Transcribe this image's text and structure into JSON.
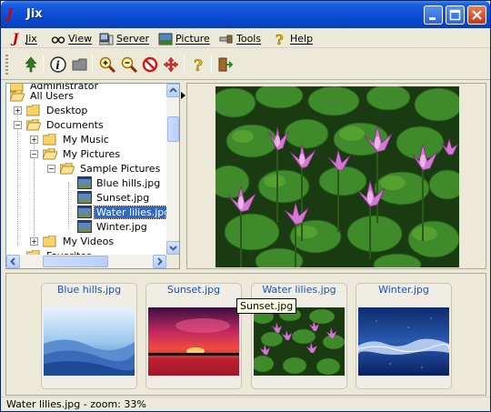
{
  "window": {
    "title": "Jix"
  },
  "menu": {
    "items": [
      {
        "label": "Jix",
        "icon": "j-logo-icon"
      },
      {
        "label": "View",
        "icon": "glasses-icon"
      },
      {
        "label": "Server",
        "icon": "server-icon"
      },
      {
        "label": "Picture",
        "icon": "picture-icon"
      },
      {
        "label": "Tools",
        "icon": "tools-icon"
      },
      {
        "label": "Help",
        "icon": "help-icon"
      }
    ]
  },
  "toolbar": {
    "tools": [
      "tree-icon",
      "info-icon",
      "up-folder-icon",
      "zoom-in-icon",
      "zoom-out-icon",
      "no-zoom-icon",
      "fit-icon",
      "help-icon",
      "exit-icon"
    ]
  },
  "tree": {
    "items": [
      {
        "label": "Administrator"
      },
      {
        "label": "All Users"
      },
      {
        "label": "Desktop"
      },
      {
        "label": "Documents"
      },
      {
        "label": "My Music"
      },
      {
        "label": "My Pictures"
      },
      {
        "label": "Sample Pictures"
      },
      {
        "label": "Blue hills.jpg"
      },
      {
        "label": "Sunset.jpg"
      },
      {
        "label": "Water lilies.jpg"
      },
      {
        "label": "Winter.jpg"
      },
      {
        "label": "My Videos"
      },
      {
        "label": "Favorites"
      }
    ],
    "selected": "Water lilies.jpg"
  },
  "thumbnails": [
    {
      "caption": "Blue hills.jpg"
    },
    {
      "caption": "Sunset.jpg"
    },
    {
      "caption": "Water lilies.jpg"
    },
    {
      "caption": "Winter.jpg"
    }
  ],
  "tooltip": {
    "text": "Sunset.jpg"
  },
  "status": {
    "text": "Water lilies.jpg - zoom: 33%"
  },
  "colors": {
    "titlebar": "#0a4fd7",
    "selection": "#316ac5",
    "caption": "#1c4fb8"
  }
}
